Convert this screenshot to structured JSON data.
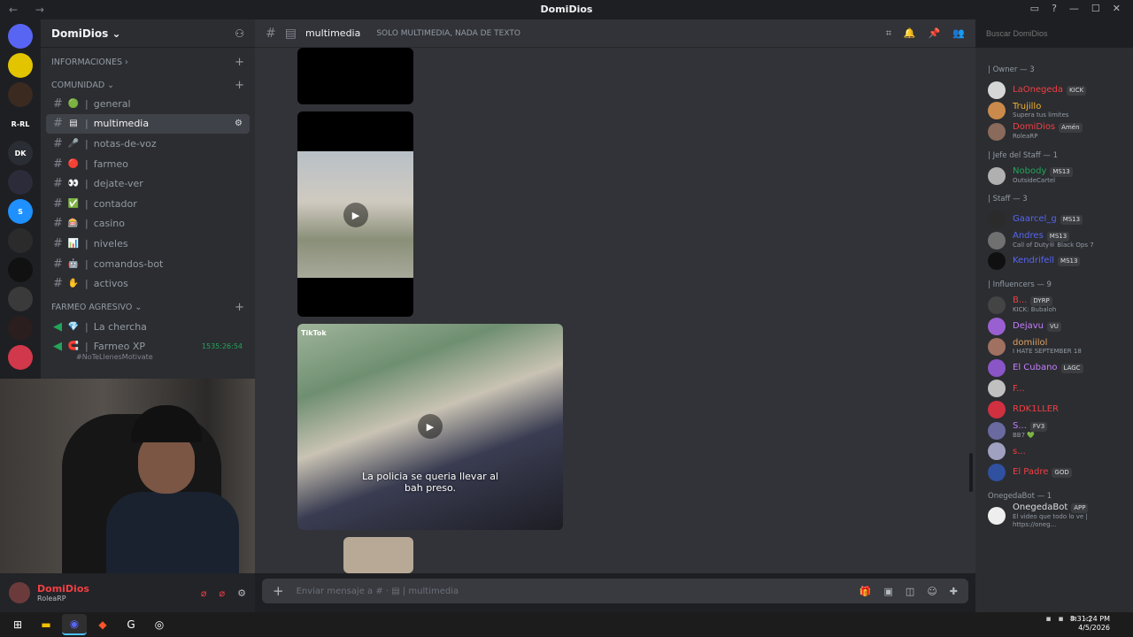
{
  "window": {
    "title": "DomiDios"
  },
  "server": {
    "name": "DomiDios ⌄"
  },
  "servers": [
    {
      "label": "",
      "color": "#5865f2",
      "icon": "discord-icon"
    },
    {
      "label": "",
      "color": "#e3c400"
    },
    {
      "label": "",
      "color": "#3a2a20"
    },
    {
      "label": "R-RL",
      "color": "#1e1f22"
    },
    {
      "label": "DK",
      "color": "#2a2d33"
    },
    {
      "label": "",
      "color": "#2b2b3a"
    },
    {
      "label": "S",
      "color": "#1e90ff"
    },
    {
      "label": "",
      "color": "#2b2b2b"
    },
    {
      "label": "",
      "color": "#111111"
    },
    {
      "label": "",
      "color": "#3a3a3a"
    },
    {
      "label": "",
      "color": "#2a1e1e"
    },
    {
      "label": "",
      "color": "#d1384b"
    }
  ],
  "categories": {
    "info": "INFORMACIONES ›",
    "comunidad": "COMUNIDAD ⌄",
    "farmeo": "FARMEO AGRESIVO ⌄"
  },
  "channels": [
    {
      "name": "general",
      "emoji": "🟢",
      "active": false
    },
    {
      "name": "multimedia",
      "emoji": "▤",
      "active": true
    },
    {
      "name": "notas-de-voz",
      "emoji": "🎤",
      "active": false
    },
    {
      "name": "farmeo",
      "emoji": "🔴",
      "active": false
    },
    {
      "name": "dejate-ver",
      "emoji": "👀",
      "active": false
    },
    {
      "name": "contador",
      "emoji": "✅",
      "active": false
    },
    {
      "name": "casino",
      "emoji": "🎰",
      "active": false
    },
    {
      "name": "niveles",
      "emoji": "📊",
      "active": false
    },
    {
      "name": "comandos-bot",
      "emoji": "🤖",
      "active": false
    },
    {
      "name": "activos",
      "emoji": "✋",
      "active": false
    }
  ],
  "voice": [
    {
      "name": "La chercha",
      "emoji": "💎",
      "time": "",
      "sub": ""
    },
    {
      "name": "Farmeo XP",
      "emoji": "🧲",
      "time": "1535:26:54",
      "sub": "#NoTeLlenesMotivate"
    }
  ],
  "user": {
    "name": "DomiDios",
    "status": "RoleaRP"
  },
  "topbar": {
    "channel": "multimedia",
    "description": "SOLO MULTIMEDIA, NADA DE TEXTO"
  },
  "search": {
    "placeholder": "Buscar DomiDios"
  },
  "media": {
    "caption": "La policia se queria llevar al bah preso.",
    "tiktok": "TikTok"
  },
  "composer": {
    "placeholder": "Enviar mensaje a # · ▤ | multimedia"
  },
  "members": {
    "roles": [
      {
        "title": "| Owner — 3",
        "items": [
          {
            "name": "LaOnegeda",
            "color": "#f23f43",
            "status": "",
            "badge": "KICK"
          },
          {
            "name": "Trujillo",
            "color": "#f0b232",
            "status": "Supera tus limites",
            "badge": ""
          },
          {
            "name": "DomiDios",
            "color": "#f23f43",
            "status": "RoleaRP",
            "badge": "Amén"
          }
        ]
      },
      {
        "title": "| Jefe del Staff — 1",
        "items": [
          {
            "name": "Nobody",
            "color": "#23a55a",
            "status": "OutsideCartel",
            "badge": "MS13"
          }
        ]
      },
      {
        "title": "| Staff — 3",
        "items": [
          {
            "name": "Gaarcel_g",
            "color": "#5865f2",
            "status": "",
            "badge": "MS13"
          },
          {
            "name": "Andres",
            "color": "#5865f2",
            "status": "Call of Duty® Black Ops 7",
            "badge": "MS13"
          },
          {
            "name": "Kendrifell",
            "color": "#5865f2",
            "status": "",
            "badge": "MS13"
          }
        ]
      },
      {
        "title": "| Influencers — 9",
        "items": [
          {
            "name": "B...",
            "color": "#f23f43",
            "status": "KICK: Bubaloh",
            "badge": "DYRP"
          },
          {
            "name": "Dejavu",
            "color": "#c77dff",
            "status": "",
            "badge": "VU"
          },
          {
            "name": "domiilol",
            "color": "#e0a060",
            "status": "I HATE SEPTEMBER 18",
            "badge": ""
          },
          {
            "name": "El Cubano",
            "color": "#c77dff",
            "status": "",
            "badge": "LAGC"
          },
          {
            "name": "F...",
            "color": "#f23f43",
            "status": "",
            "badge": ""
          },
          {
            "name": "RDK1LLER",
            "color": "#f23f43",
            "status": "",
            "badge": ""
          },
          {
            "name": "S...",
            "color": "#c77dff",
            "status": "BB7 💚",
            "badge": "FV3"
          },
          {
            "name": "s...",
            "color": "#f23f43",
            "status": "",
            "badge": ""
          },
          {
            "name": "El Padre",
            "color": "#f23f43",
            "status": "",
            "badge": "GOD"
          }
        ]
      },
      {
        "title": "OnegedaBot — 1",
        "items": [
          {
            "name": "OnegedaBot",
            "color": "#dbdee1",
            "status": "El video que todo lo ve | https://oneg...",
            "badge": "APP"
          }
        ]
      }
    ]
  },
  "clock": {
    "time": "8:31:24 PM",
    "date": "4/5/2026"
  }
}
